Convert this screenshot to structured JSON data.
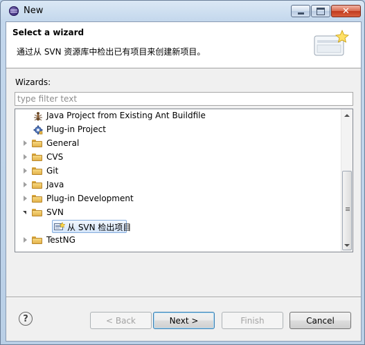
{
  "window": {
    "title": "New"
  },
  "header": {
    "title": "Select a wizard",
    "description": "通过从 SVN 资源库中检出已有项目来创建新项目。"
  },
  "wizards_label": "Wizards:",
  "filter": {
    "placeholder": "type filter text",
    "value": ""
  },
  "tree": {
    "items": [
      {
        "label": "Java Project from Existing Ant Buildfile",
        "icon": "ant-icon",
        "level": 1
      },
      {
        "label": "Plug-in Project",
        "icon": "plugin-project-icon",
        "level": 1
      },
      {
        "label": "General",
        "icon": "folder-icon",
        "expanded": false
      },
      {
        "label": "CVS",
        "icon": "folder-icon",
        "expanded": false
      },
      {
        "label": "Git",
        "icon": "folder-icon",
        "expanded": false
      },
      {
        "label": "Java",
        "icon": "folder-icon",
        "expanded": false
      },
      {
        "label": "Plug-in Development",
        "icon": "folder-icon",
        "expanded": false
      },
      {
        "label": "SVN",
        "icon": "folder-icon",
        "expanded": true
      },
      {
        "label": "从 SVN 检出项目",
        "icon": "svn-checkout-icon",
        "selected": true,
        "level": 1
      },
      {
        "label": "TestNG",
        "icon": "folder-icon",
        "expanded": false
      }
    ]
  },
  "buttons": {
    "back": "< Back",
    "next": "Next >",
    "finish": "Finish",
    "cancel": "Cancel"
  },
  "colors": {
    "folder": "#e3b34c",
    "selection": "#d5e6fa",
    "title_bar": "#c3d7ec"
  }
}
